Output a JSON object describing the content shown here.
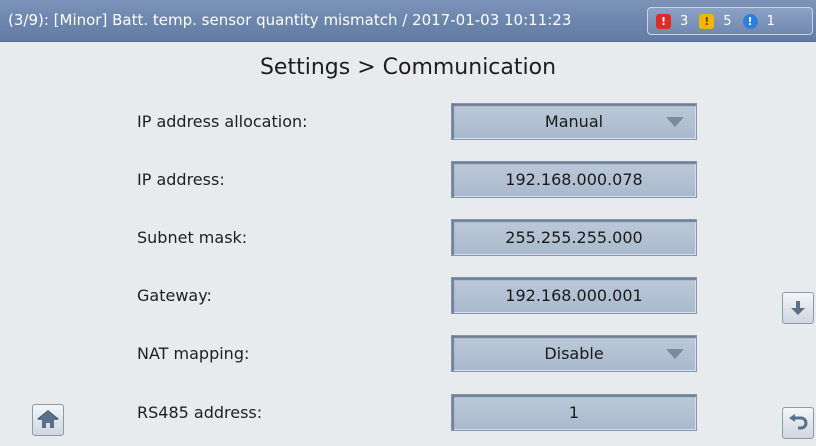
{
  "alarm": {
    "message": "(3/9): [Minor] Batt. temp. sensor quantity mismatch / 2017-01-03 10:11:23",
    "critical_count": "3",
    "major_count": "5",
    "minor_count": "1",
    "colors": {
      "critical": "#e02a2a",
      "major": "#f2b705",
      "minor": "#2b7fe0"
    }
  },
  "page": {
    "title": "Settings > Communication"
  },
  "settings": [
    {
      "label": "IP address allocation:",
      "value": "Manual",
      "type": "dropdown"
    },
    {
      "label": "IP address:",
      "value": "192.168.000.078",
      "type": "text"
    },
    {
      "label": "Subnet mask:",
      "value": "255.255.255.000",
      "type": "text"
    },
    {
      "label": "Gateway:",
      "value": "192.168.000.001",
      "type": "text"
    },
    {
      "label": "NAT mapping:",
      "value": "Disable",
      "type": "dropdown"
    },
    {
      "label": "RS485 address:",
      "value": "1",
      "type": "text"
    }
  ],
  "nav": {
    "home_icon": "home-icon",
    "scroll_icon": "arrow-down-icon",
    "back_icon": "back-arrow-icon"
  }
}
